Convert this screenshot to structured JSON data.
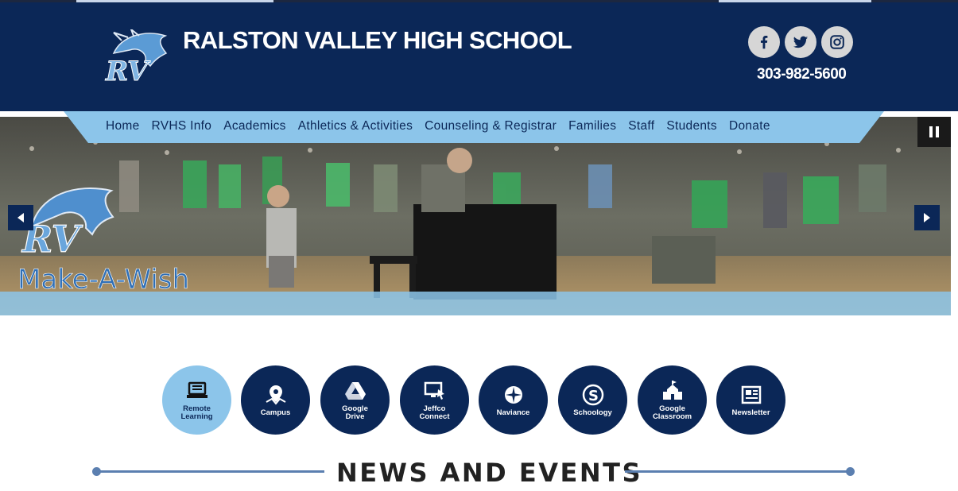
{
  "header": {
    "school_name": "RALSTON VALLEY HIGH SCHOOL",
    "phone": "303-982-5600",
    "logo_text": "RV",
    "social": [
      {
        "name": "facebook",
        "glyph": "f"
      },
      {
        "name": "twitter",
        "glyph": "twitter"
      },
      {
        "name": "instagram",
        "glyph": "instagram"
      }
    ]
  },
  "nav": {
    "items": [
      "Home",
      "RVHS Info",
      "Academics",
      "Athletics & Activities",
      "Counseling & Registrar",
      "Families",
      "Staff",
      "Students",
      "Donate"
    ]
  },
  "hero": {
    "overlay_logo_text": "RV",
    "overlay_brand": "Make-A-Wish"
  },
  "quick_links": [
    {
      "label": "Remote Learning",
      "icon": "laptop-book-icon",
      "active": true
    },
    {
      "label": "Campus",
      "icon": "map-pin-icon",
      "active": false
    },
    {
      "label": "Google Drive",
      "icon": "google-drive-icon",
      "active": false
    },
    {
      "label": "Jeffco Connect",
      "icon": "monitor-cursor-icon",
      "active": false
    },
    {
      "label": "Naviance",
      "icon": "compass-icon",
      "active": false
    },
    {
      "label": "Schoology",
      "icon": "schoology-icon",
      "active": false
    },
    {
      "label": "Google Classroom",
      "icon": "schoolhouse-icon",
      "active": false
    },
    {
      "label": "Newsletter",
      "icon": "newspaper-icon",
      "active": false
    }
  ],
  "section": {
    "title": "NEWS AND EVENTS"
  },
  "colors": {
    "navy": "#0b2757",
    "light_blue": "#8cc5ea",
    "line_blue": "#5b7fb0"
  }
}
